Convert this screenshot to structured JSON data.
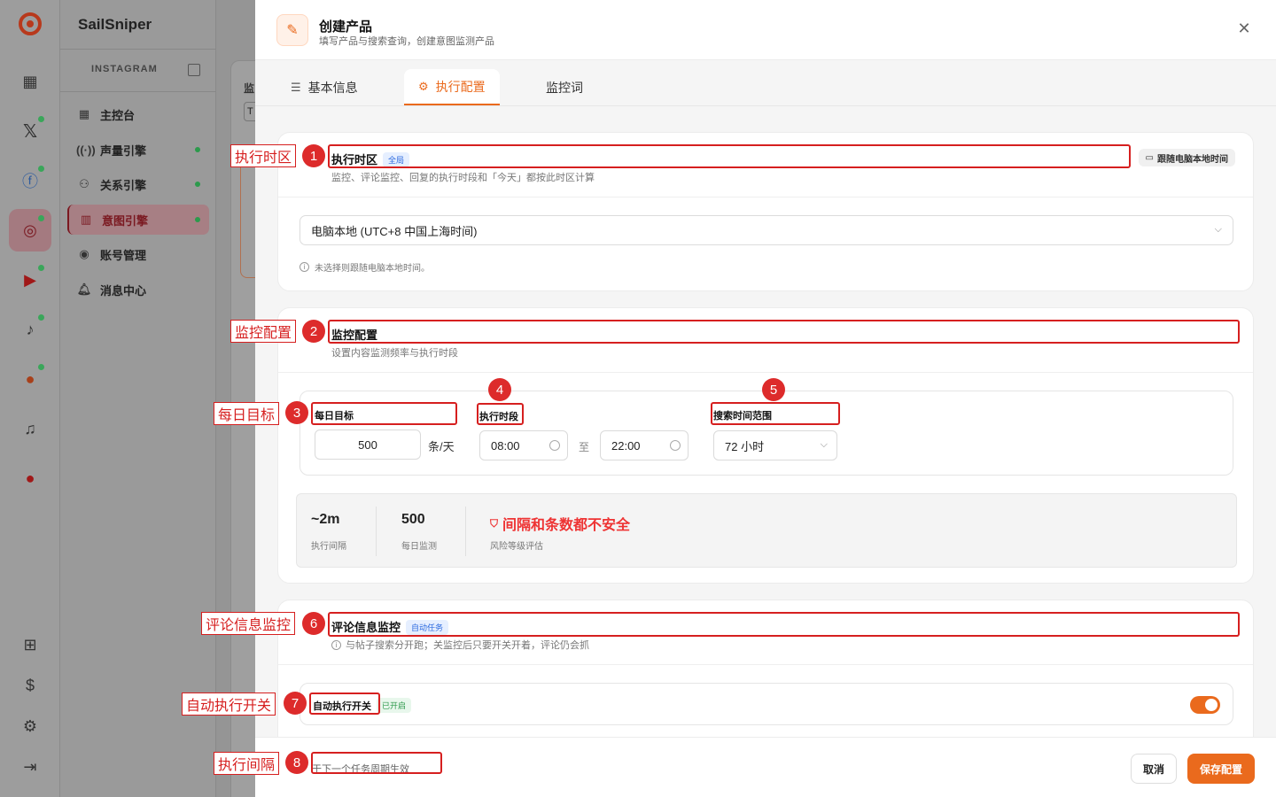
{
  "app": {
    "brand": "SailSniper",
    "section": "INSTAGRAM"
  },
  "sidebar": {
    "items": [
      {
        "label": "主控台",
        "icon": "grid-icon",
        "dot": false,
        "active": false
      },
      {
        "label": "声量引擎",
        "icon": "radio-icon",
        "dot": true,
        "active": false
      },
      {
        "label": "关系引擎",
        "icon": "users-icon",
        "dot": true,
        "active": false
      },
      {
        "label": "意图引擎",
        "icon": "bar-chart-icon",
        "dot": true,
        "active": true
      },
      {
        "label": "账号管理",
        "icon": "user-circle-icon",
        "dot": false,
        "active": false
      },
      {
        "label": "消息中心",
        "icon": "bell-icon",
        "dot": false,
        "active": false
      }
    ]
  },
  "main": {
    "partial_title": "监",
    "partial_input": "T"
  },
  "drawer": {
    "title": "创建产品",
    "subtitle": "填写产品与搜索查询，创建意图监测产品",
    "tabs": [
      {
        "label": "基本信息",
        "icon": "sliders-icon",
        "active": false
      },
      {
        "label": "执行配置",
        "icon": "gear-icon",
        "active": true
      },
      {
        "label": "监控词",
        "icon": "",
        "active": false
      }
    ],
    "timezone": {
      "title": "执行时区",
      "badge": "全局",
      "subtitle": "监控、评论监控、回复的执行时段和「今天」都按此时区计算",
      "follow_button": "跟随电脑本地时间",
      "selected": "电脑本地 (UTC+8 中国上海时间)",
      "hint": "未选择则跟随电脑本地时间。"
    },
    "monitor": {
      "title": "监控配置",
      "subtitle": "设置内容监测频率与执行时段",
      "daily_target_label": "每日目标",
      "daily_target_value": "500",
      "daily_target_unit": "条/天",
      "period_label": "执行时段",
      "start_time": "08:00",
      "to": "至",
      "end_time": "22:00",
      "range_label": "搜索时间范围",
      "range_value": "72 小时",
      "stats": {
        "interval_value": "~2m",
        "interval_label": "执行间隔",
        "daily_value": "500",
        "daily_label": "每日监测",
        "risk_value": "间隔和条数都不安全",
        "risk_label": "风险等级评估"
      }
    },
    "comment": {
      "title": "评论信息监控",
      "badge": "自动任务",
      "subtitle": "与帖子搜索分开跑；关监控后只要开关开着，评论仍会抓",
      "auto_label": "自动执行开关",
      "auto_badge": "已开启",
      "auto_on": true
    },
    "footer": {
      "note": "于下一个任务周期生效",
      "cancel": "取消",
      "save": "保存配置"
    }
  },
  "annotations": [
    {
      "num": "1",
      "label": "执行时区"
    },
    {
      "num": "2",
      "label": "监控配置"
    },
    {
      "num": "3",
      "label": "每日目标"
    },
    {
      "num": "4",
      "label": ""
    },
    {
      "num": "5",
      "label": ""
    },
    {
      "num": "6",
      "label": "评论信息监控"
    },
    {
      "num": "7",
      "label": "自动执行开关"
    },
    {
      "num": "8",
      "label": "执行间隔"
    }
  ],
  "colors": {
    "accent": "#ea6a1d",
    "annotation": "#d61f1f",
    "danger": "#e33333",
    "badge_blue": "#2d6bdf",
    "badge_green": "#2f9a4d"
  }
}
